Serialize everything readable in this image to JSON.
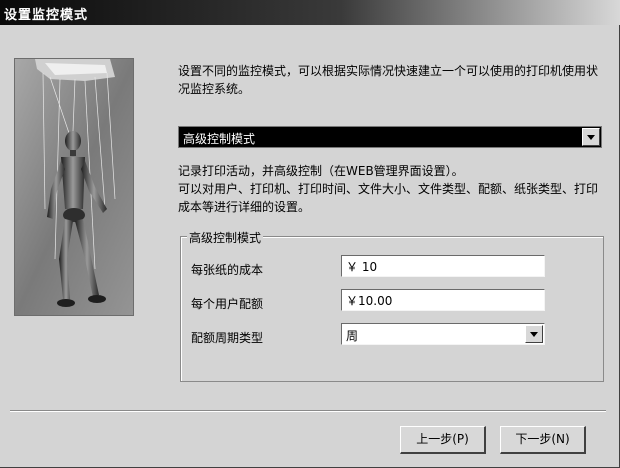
{
  "window": {
    "title": "设置监控模式"
  },
  "intro": {
    "text": "设置不同的监控模式，可以根据实际情况快速建立一个可以使用的打印机使用状况监控系统。"
  },
  "mode_select": {
    "selected": "高级控制模式"
  },
  "description": {
    "line1": "记录打印活动，并高级控制（在WEB管理界面设置）。",
    "line2": "可以对用户、打印机、打印时间、文件大小、文件类型、配额、纸张类型、打印成本等进行详细的设置。"
  },
  "group": {
    "title": "高级控制模式",
    "cost_per_sheet": {
      "label": "每张纸的成本",
      "value": "￥ 10"
    },
    "user_quota": {
      "label": "每个用户配额",
      "value": "￥10.00"
    },
    "quota_period": {
      "label": "配额周期类型",
      "selected": "周"
    }
  },
  "buttons": {
    "back": "上一步(P)",
    "next": "下一步(N)"
  }
}
